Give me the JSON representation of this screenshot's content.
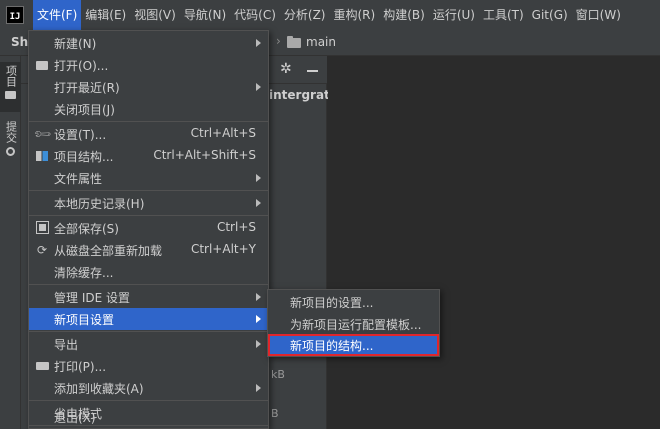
{
  "menubar": {
    "logo_text": "IJ",
    "items": [
      "文件(F)",
      "编辑(E)",
      "视图(V)",
      "导航(N)",
      "代码(C)",
      "分析(Z)",
      "重构(R)",
      "构建(B)",
      "运行(U)",
      "工具(T)",
      "Git(G)",
      "窗口(W)"
    ]
  },
  "navbar": {
    "project": "Sh",
    "folder": "main"
  },
  "leftstrip": {
    "project_tab": "项目",
    "commit_tab": "提交"
  },
  "panel": {
    "tree_label": "intergratio",
    "size_1": "kB",
    "size_2": "B"
  },
  "file_menu": [
    {
      "label": "新建(N)",
      "shortcut": "",
      "submenu": true,
      "icon": ""
    },
    {
      "label": "打开(O)...",
      "shortcut": "",
      "submenu": false,
      "icon": "folder-open-icon"
    },
    {
      "label": "打开最近(R)",
      "shortcut": "",
      "submenu": true,
      "icon": ""
    },
    {
      "label": "关闭项目(J)",
      "shortcut": "",
      "submenu": false,
      "icon": ""
    },
    {
      "label": "设置(T)...",
      "shortcut": "Ctrl+Alt+S",
      "submenu": false,
      "icon": "wrench-icon"
    },
    {
      "label": "项目结构...",
      "shortcut": "Ctrl+Alt+Shift+S",
      "submenu": false,
      "icon": "project-structure-icon"
    },
    {
      "label": "文件属性",
      "shortcut": "",
      "submenu": true,
      "icon": ""
    },
    {
      "label": "本地历史记录(H)",
      "shortcut": "",
      "submenu": true,
      "icon": ""
    },
    {
      "label": "全部保存(S)",
      "shortcut": "Ctrl+S",
      "submenu": false,
      "icon": "save-icon"
    },
    {
      "label": "从磁盘全部重新加载",
      "shortcut": "Ctrl+Alt+Y",
      "submenu": false,
      "icon": "reload-icon"
    },
    {
      "label": "清除缓存...",
      "shortcut": "",
      "submenu": false,
      "icon": ""
    },
    {
      "label": "管理 IDE 设置",
      "shortcut": "",
      "submenu": true,
      "icon": ""
    },
    {
      "label": "新项目设置",
      "shortcut": "",
      "submenu": true,
      "icon": ""
    },
    {
      "label": "导出",
      "shortcut": "",
      "submenu": true,
      "icon": ""
    },
    {
      "label": "打印(P)...",
      "shortcut": "",
      "submenu": false,
      "icon": "print-icon"
    },
    {
      "label": "添加到收藏夹(A)",
      "shortcut": "",
      "submenu": true,
      "icon": ""
    },
    {
      "label": "省电模式",
      "shortcut": "",
      "submenu": false,
      "icon": ""
    },
    {
      "label": "退出(X)",
      "shortcut": "",
      "submenu": false,
      "icon": ""
    }
  ],
  "new_project_settings_submenu": [
    "新项目的设置...",
    "为新项目运行配置模板...",
    "新项目的结构..."
  ],
  "colors": {
    "accent": "#2f65ca",
    "menu_bg": "#3c3f41",
    "editor_bg": "#2b2b2b",
    "highlight_box": "#e0262c"
  }
}
